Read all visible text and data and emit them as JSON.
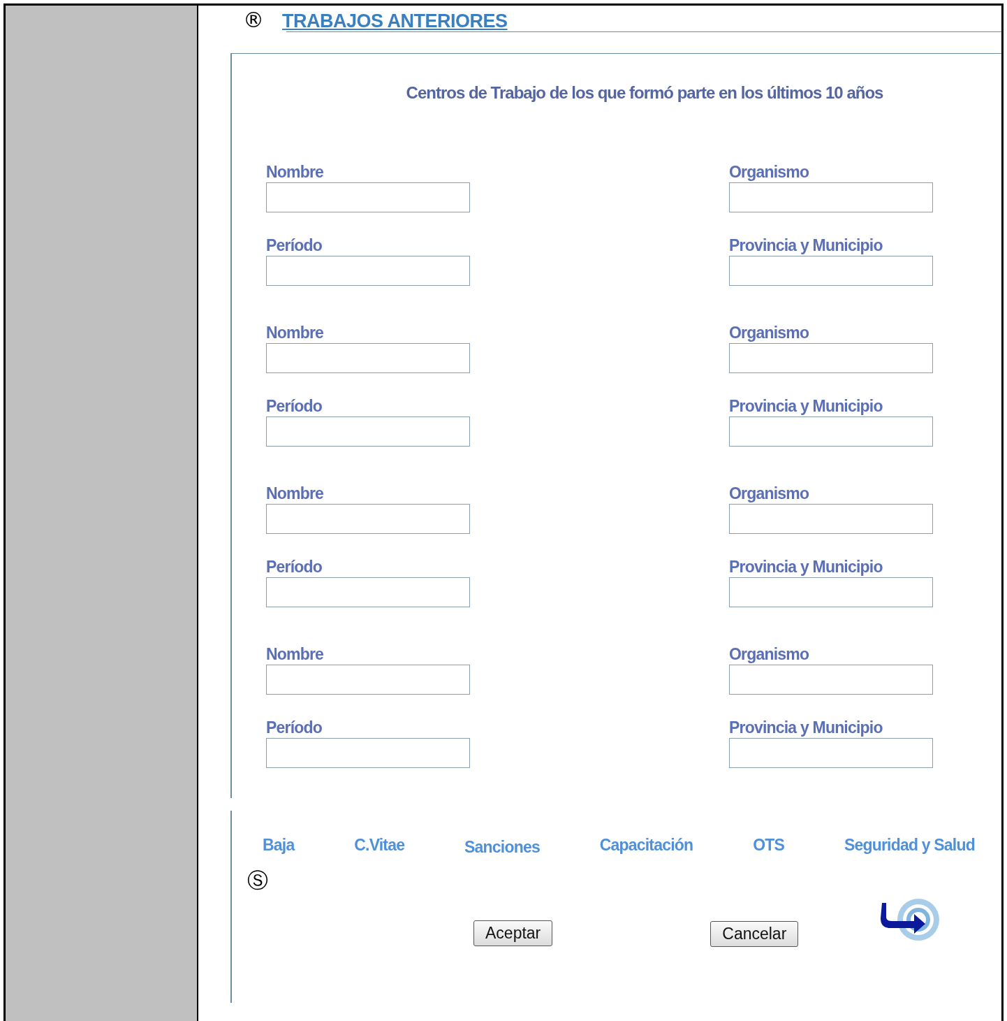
{
  "header": {
    "marker": "®",
    "title": "TRABAJOS ANTERIORES"
  },
  "subtitle": "Centros de Trabajo de los que formó parte en los últimos 10 años",
  "groups": [
    {
      "fields": [
        {
          "label": "Nombre"
        },
        {
          "label": "Organismo"
        },
        {
          "label": "Período"
        },
        {
          "label": "Provincia y Municipio"
        }
      ]
    },
    {
      "fields": [
        {
          "label": "Nombre"
        },
        {
          "label": "Organismo"
        },
        {
          "label": "Período"
        },
        {
          "label": "Provincia y Municipio"
        }
      ]
    },
    {
      "fields": [
        {
          "label": "Nombre"
        },
        {
          "label": "Organismo"
        },
        {
          "label": "Período"
        },
        {
          "label": "Provincia y Municipio"
        }
      ]
    },
    {
      "fields": [
        {
          "label": "Nombre"
        },
        {
          "label": "Organismo"
        },
        {
          "label": "Período"
        },
        {
          "label": "Provincia y Municipio"
        }
      ]
    }
  ],
  "links": [
    "Baja",
    "C.Vitae",
    "Sanciones",
    "Capacitación",
    "OTS",
    "Seguridad y Salud"
  ],
  "footer_marker": "Ⓢ",
  "buttons": [
    "Aceptar",
    "Cancelar"
  ]
}
